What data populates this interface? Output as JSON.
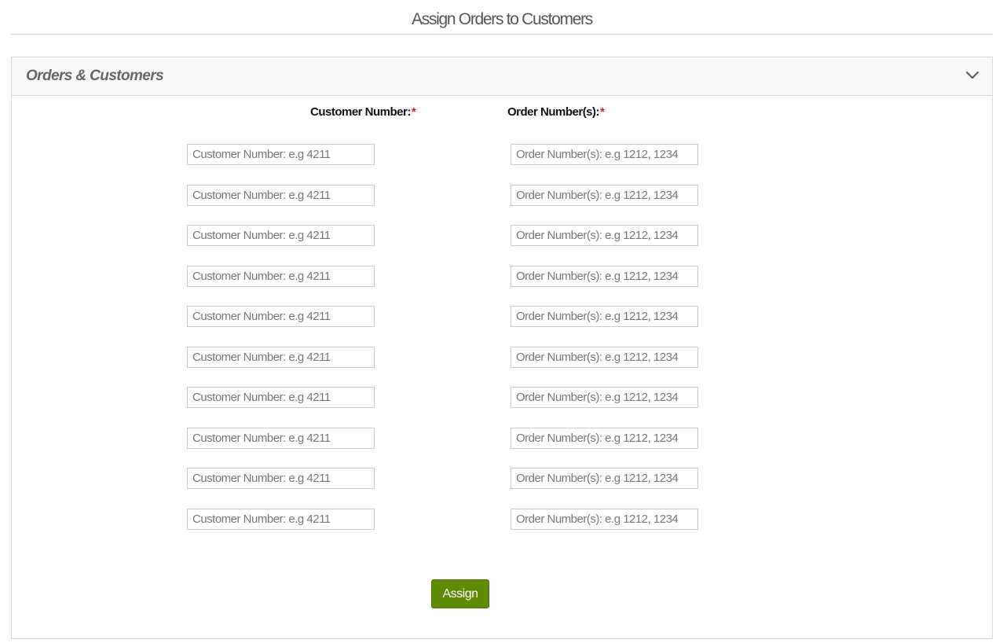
{
  "page": {
    "title": "Assign Orders to Customers"
  },
  "panel": {
    "title": "Orders & Customers",
    "toggle_icon": "chevron-down-icon"
  },
  "form": {
    "customer_label": "Customer Number:",
    "order_label": "Order Number(s):",
    "required_marker": "*",
    "rows": [
      {
        "customer_value": "",
        "customer_placeholder": "Customer Number: e.g 4211",
        "order_value": "",
        "order_placeholder": "Order Number(s): e.g 1212, 1234"
      },
      {
        "customer_value": "",
        "customer_placeholder": "Customer Number: e.g 4211",
        "order_value": "",
        "order_placeholder": "Order Number(s): e.g 1212, 1234"
      },
      {
        "customer_value": "",
        "customer_placeholder": "Customer Number: e.g 4211",
        "order_value": "",
        "order_placeholder": "Order Number(s): e.g 1212, 1234"
      },
      {
        "customer_value": "",
        "customer_placeholder": "Customer Number: e.g 4211",
        "order_value": "",
        "order_placeholder": "Order Number(s): e.g 1212, 1234"
      },
      {
        "customer_value": "",
        "customer_placeholder": "Customer Number: e.g 4211",
        "order_value": "",
        "order_placeholder": "Order Number(s): e.g 1212, 1234"
      },
      {
        "customer_value": "",
        "customer_placeholder": "Customer Number: e.g 4211",
        "order_value": "",
        "order_placeholder": "Order Number(s): e.g 1212, 1234"
      },
      {
        "customer_value": "",
        "customer_placeholder": "Customer Number: e.g 4211",
        "order_value": "",
        "order_placeholder": "Order Number(s): e.g 1212, 1234"
      },
      {
        "customer_value": "",
        "customer_placeholder": "Customer Number: e.g 4211",
        "order_value": "",
        "order_placeholder": "Order Number(s): e.g 1212, 1234"
      },
      {
        "customer_value": "",
        "customer_placeholder": "Customer Number: e.g 4211",
        "order_value": "",
        "order_placeholder": "Order Number(s): e.g 1212, 1234"
      },
      {
        "customer_value": "",
        "customer_placeholder": "Customer Number: e.g 4211",
        "order_value": "",
        "order_placeholder": "Order Number(s): e.g 1212, 1234"
      }
    ],
    "submit_label": "Assign"
  },
  "colors": {
    "accent": "#5e8a04",
    "required": "#e0191f",
    "panel_header_bg": "#f7f8fa",
    "border": "#d8d8d8"
  }
}
